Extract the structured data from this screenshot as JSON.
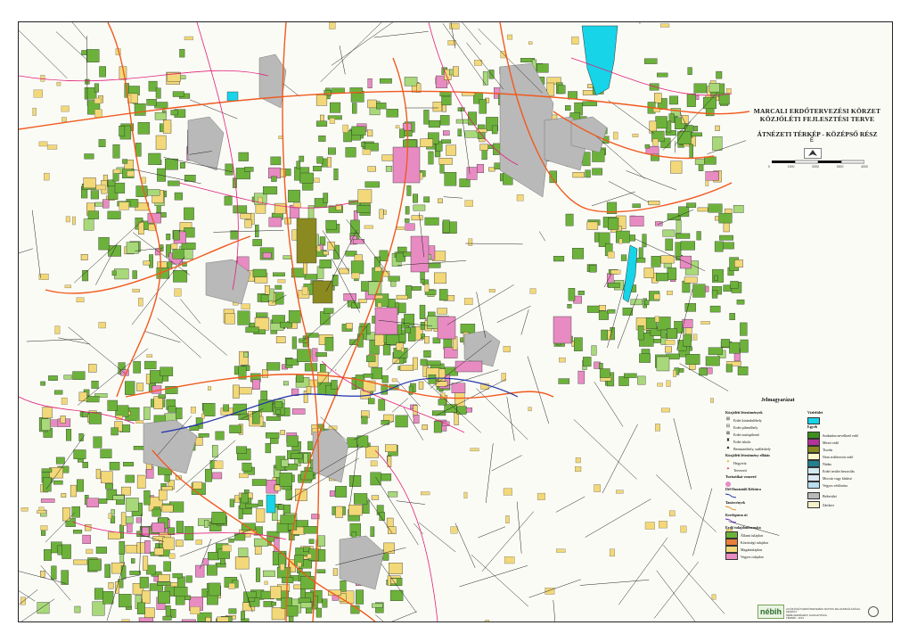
{
  "map": {
    "title_line1": "MARCALI ERDŐTERVEZÉSI KÖRZET",
    "title_line2": "KÖZJÓLÉTI FEJLESZTÉSI TERVE",
    "subtitle": "ÁTNÉZETI TÉRKÉP - KÖZÉPSŐ RÉSZ",
    "north_label": "É",
    "scale_labels": [
      "0",
      "1000",
      "2000",
      "3000",
      "4000"
    ]
  },
  "legend": {
    "title": "Jelmagyarázat",
    "col1_head": "Közjóléti létesítmények",
    "facilities": [
      {
        "icon": "picnic-table-icon",
        "glyph": "⊞",
        "label": "Erdei kirándulóhely"
      },
      {
        "icon": "rest-area-icon",
        "glyph": "⊟",
        "label": "Erdei pihenőhely"
      },
      {
        "icon": "car-park-icon",
        "glyph": "⊠",
        "label": "Erdei autóspihenő"
      },
      {
        "icon": "school-icon",
        "glyph": "♜",
        "label": "Erdei iskola"
      },
      {
        "icon": "hut-icon",
        "glyph": "▲",
        "label": "Bemutatóhely, szálláshely"
      }
    ],
    "col1_head2": "Közjóléti létesítmény ellátás",
    "points": [
      {
        "icon": "spring-icon",
        "glyph": "✦",
        "label": "Hegyivíz"
      },
      {
        "icon": "viewpoint-icon",
        "glyph": "✦",
        "label": "Tervezett"
      }
    ],
    "trail_head": "Turisztikai vonzerő",
    "trail_items": [
      {
        "label": "Dél-Dunántúli Kéktúra",
        "color": "#2233aa"
      },
      {
        "label": "Tanösvények",
        "color": "#e09020"
      },
      {
        "label": "Kerékpáros út",
        "color": "#6633cc"
      }
    ],
    "ownership_head": "Erdő tulajdonformája",
    "ownership": [
      {
        "label": "Állami tulajdon",
        "color": "#6cb23a"
      },
      {
        "label": "Közösségi tulajdon",
        "color": "#e8803a"
      },
      {
        "label": "Magántulajdon",
        "color": "#f2d878"
      },
      {
        "label": "Vegyes tulajdon",
        "color": "#e88bc2"
      }
    ],
    "col2_head": "Vízfelület",
    "water": {
      "label": "",
      "color": "#17d4e8"
    },
    "col2_head2": "Egyéb",
    "other": [
      {
        "label": "Szabadon nevelhető erdő",
        "color": "#3e8f1e"
      },
      {
        "label": "Mezei erdő",
        "color": "#b4329a"
      },
      {
        "label": "Tisztás",
        "color": "#8a8a20"
      },
      {
        "label": "Nem erdőterveti erdő",
        "color": "#fff8c8"
      },
      {
        "label": "Nádas",
        "color": "#208090"
      },
      {
        "label": "Erdei terület besorolás",
        "color": "#cfe9ef"
      },
      {
        "label": "Mocsár vagy fáslásó",
        "color": "#dce8f4"
      },
      {
        "label": "Vegyes védőzóna",
        "color": "#b8dff0"
      }
    ],
    "settlement": [
      {
        "label": "Belterület",
        "color": "#b9b9b9"
      },
      {
        "label": "Zártkert",
        "color": "#f4f0c8"
      }
    ]
  },
  "footer": {
    "logo": "nébih",
    "note": "A KÖZJÓLÉTI ERDŐTERVEZÉSI ADATOK FELHASZNÁLÁSÁVAL KÉSZÜLT",
    "note2": "NÉBIH ERDÉSZETI IGAZGATÓSÁG",
    "note3": "TÉRKÉP - 2013"
  },
  "colors": {
    "state_forest": "#6cb23a",
    "private_forest": "#f2d878",
    "mixed_forest": "#e88bc2",
    "urban": "#b9b9b9",
    "water": "#17d4e8",
    "road_main": "#f05a1e",
    "road_secondary": "#e0207a",
    "parcel_line": "#222222",
    "trail_blue": "#2233aa"
  }
}
